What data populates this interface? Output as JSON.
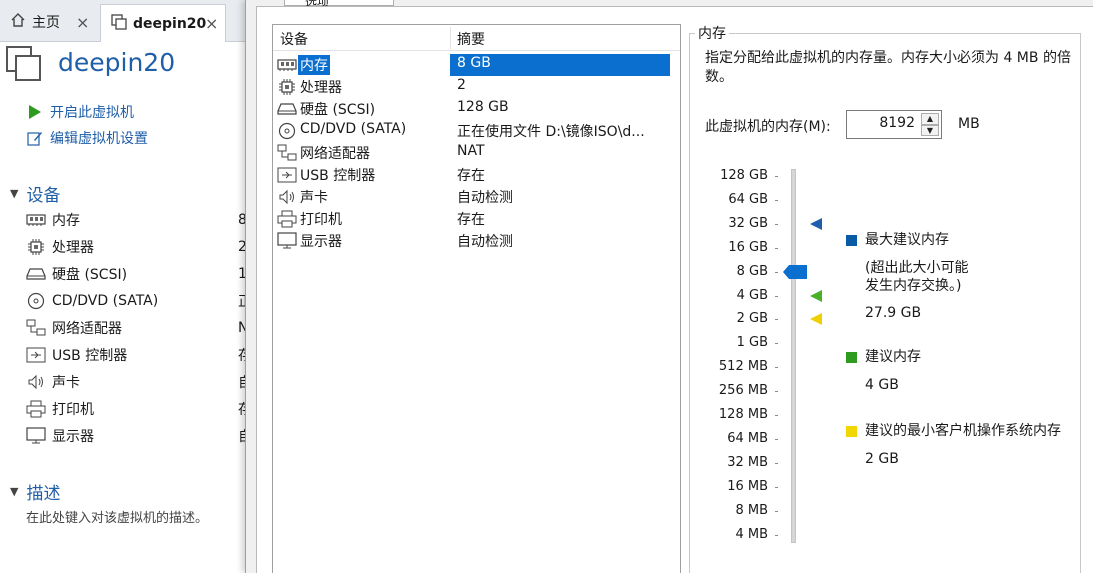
{
  "tabs": [
    {
      "label": "主页",
      "close": "×"
    },
    {
      "label": "deepin20",
      "close": "×"
    }
  ],
  "vm": {
    "name": "deepin20"
  },
  "actions": [
    {
      "label": "开启此虚拟机",
      "icon": "play-icon"
    },
    {
      "label": "编辑虚拟机设置",
      "icon": "edit-icon"
    }
  ],
  "sections": {
    "devices": "设备",
    "description": "描述"
  },
  "left_devices": [
    {
      "name": "内存",
      "value": "8",
      "icon": "memory-icon"
    },
    {
      "name": "处理器",
      "value": "2",
      "icon": "cpu-icon"
    },
    {
      "name": "硬盘 (SCSI)",
      "value": "1",
      "icon": "disk-icon"
    },
    {
      "name": "CD/DVD (SATA)",
      "value": "正",
      "icon": "cd-icon"
    },
    {
      "name": "网络适配器",
      "value": "N",
      "icon": "network-icon"
    },
    {
      "name": "USB 控制器",
      "value": "存",
      "icon": "usb-icon"
    },
    {
      "name": "声卡",
      "value": "自",
      "icon": "sound-icon"
    },
    {
      "name": "打印机",
      "value": "存",
      "icon": "printer-icon"
    },
    {
      "name": "显示器",
      "value": "自",
      "icon": "monitor-icon"
    }
  ],
  "description_placeholder": "在此处键入对该虚拟机的描述。",
  "dialog": {
    "tab_label": "选项",
    "columns": {
      "device": "设备",
      "summary": "摘要"
    },
    "devices": [
      {
        "name": "内存",
        "summary": "8 GB",
        "icon": "memory-icon",
        "selected": true
      },
      {
        "name": "处理器",
        "summary": "2",
        "icon": "cpu-icon"
      },
      {
        "name": "硬盘 (SCSI)",
        "summary": "128 GB",
        "icon": "disk-icon"
      },
      {
        "name": "CD/DVD (SATA)",
        "summary": "正在使用文件 D:\\镜像ISO\\d...",
        "icon": "cd-icon"
      },
      {
        "name": "网络适配器",
        "summary": "NAT",
        "icon": "network-icon"
      },
      {
        "name": "USB 控制器",
        "summary": "存在",
        "icon": "usb-icon"
      },
      {
        "name": "声卡",
        "summary": "自动检测",
        "icon": "sound-icon"
      },
      {
        "name": "打印机",
        "summary": "存在",
        "icon": "printer-icon"
      },
      {
        "name": "显示器",
        "summary": "自动检测",
        "icon": "monitor-icon"
      }
    ]
  },
  "memory": {
    "group_title": "内存",
    "description": "指定分配给此虚拟机的内存量。内存大小必须为 4 MB 的倍数。",
    "label": "此虚拟机的内存(M):",
    "value": "8192",
    "unit": "MB",
    "scale": [
      "128 GB",
      "64 GB",
      "32 GB",
      "16 GB",
      "8 GB",
      "4 GB",
      "2 GB",
      "1 GB",
      "512 MB",
      "256 MB",
      "128 MB",
      "64 MB",
      "32 MB",
      "16 MB",
      "8 MB",
      "4 MB"
    ],
    "current_level": "8 GB",
    "markers": [
      {
        "level": "32 GB",
        "color": "#1f5ea8"
      },
      {
        "level": "4 GB",
        "color": "#4caf2a"
      },
      {
        "level": "2 GB",
        "color": "#f0d000"
      }
    ],
    "legend": {
      "max_label": "最大建议内存",
      "max_note_1": "(超出此大小可能",
      "max_note_2": "发生内存交换。)",
      "max_value": "27.9 GB",
      "rec_label": "建议内存",
      "rec_value": "4 GB",
      "min_label": "建议的最小客户机操作系统内存",
      "min_value": "2 GB"
    },
    "colors": {
      "max": "#0b5aa6",
      "rec": "#2e9a1f",
      "min": "#f2d600",
      "thumb": "#0b6fcf"
    }
  }
}
